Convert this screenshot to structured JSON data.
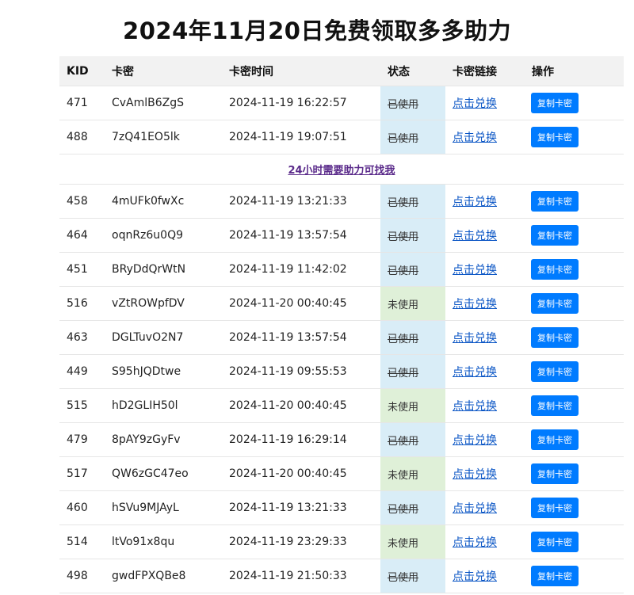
{
  "page": {
    "title": "2024年11月20日免费领取多多助力"
  },
  "table": {
    "headers": [
      "KID",
      "卡密",
      "卡密时间",
      "状态",
      "卡密链接",
      "操作"
    ],
    "link_label": "点击兑换",
    "copy_label": "复制卡密",
    "notice": "24小时需要助力可找我",
    "rows_top": [
      {
        "kid": "471",
        "key": "CvAmlB6ZgS",
        "time": "2024-11-19 16:22:57",
        "status": "已使用"
      },
      {
        "kid": "488",
        "key": "7zQ41EO5lk",
        "time": "2024-11-19 19:07:51",
        "status": "已使用"
      }
    ],
    "rows": [
      {
        "kid": "458",
        "key": "4mUFk0fwXc",
        "time": "2024-11-19 13:21:33",
        "status": "已使用"
      },
      {
        "kid": "464",
        "key": "oqnRz6u0Q9",
        "time": "2024-11-19 13:57:54",
        "status": "已使用"
      },
      {
        "kid": "451",
        "key": "BRyDdQrWtN",
        "time": "2024-11-19 11:42:02",
        "status": "已使用"
      },
      {
        "kid": "516",
        "key": "vZtROWpfDV",
        "time": "2024-11-20 00:40:45",
        "status": "未使用"
      },
      {
        "kid": "463",
        "key": "DGLTuvO2N7",
        "time": "2024-11-19 13:57:54",
        "status": "已使用"
      },
      {
        "kid": "449",
        "key": "S95hJQDtwe",
        "time": "2024-11-19 09:55:53",
        "status": "已使用"
      },
      {
        "kid": "515",
        "key": "hD2GLIH50l",
        "time": "2024-11-20 00:40:45",
        "status": "未使用"
      },
      {
        "kid": "479",
        "key": "8pAY9zGyFv",
        "time": "2024-11-19 16:29:14",
        "status": "已使用"
      },
      {
        "kid": "517",
        "key": "QW6zGC47eo",
        "time": "2024-11-20 00:40:45",
        "status": "未使用"
      },
      {
        "kid": "460",
        "key": "hSVu9MJAyL",
        "time": "2024-11-19 13:21:33",
        "status": "已使用"
      },
      {
        "kid": "514",
        "key": "ltVo91x8qu",
        "time": "2024-11-19 23:29:33",
        "status": "未使用"
      },
      {
        "kid": "498",
        "key": "gwdFPXQBe8",
        "time": "2024-11-19 21:50:33",
        "status": "已使用"
      }
    ]
  },
  "colors": {
    "used_bg": "#d9edf7",
    "unused_bg": "#dff0d8",
    "button": "#007bff",
    "link": "#0b56c5",
    "notice": "#5a2a8a"
  }
}
